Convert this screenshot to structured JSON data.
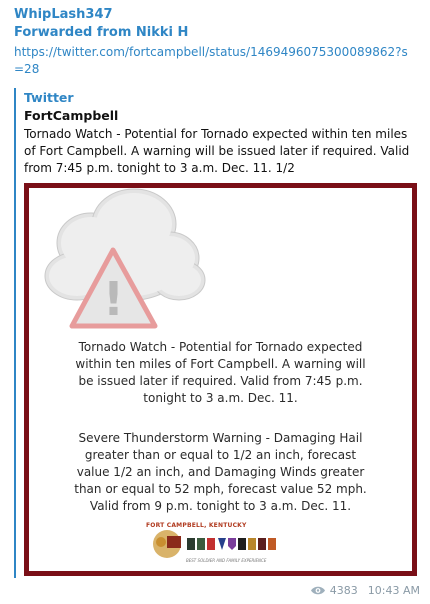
{
  "message": {
    "sender": "WhipLash347",
    "forwarded_from": "Forwarded from Nikki H",
    "link": "https://twitter.com/fortcampbell/status/1469496075300089862?s=28"
  },
  "preview": {
    "site_name": "Twitter",
    "title": "FortCampbell",
    "description": "Tornado Watch - Potential for Tornado expected within ten miles of Fort Campbell. A warning will be issued later if required. Valid from 7:45 p.m. tonight to 3 a.m. Dec. 11. 1/2"
  },
  "card": {
    "paragraph1": "Tornado Watch - Potential for Tornado expected within ten miles of Fort Campbell. A warning will be issued later if required. Valid from 7:45 p.m. tonight to 3 a.m. Dec. 11.",
    "paragraph2": "Severe Thunderstorm Warning - Damaging Hail greater than or equal to 1/2 an inch, forecast value 1/2 an inch, and Damaging Winds greater than or equal to 52 mph, forecast value 52 mph. Valid from 9 p.m. tonight to 3 a.m. Dec. 11.",
    "logo_title": "FORT CAMPBELL, KENTUCKY",
    "logo_subtitle": "BEST SOLDIER AND FAMILY EXPERIENCE",
    "warning_symbol": "!",
    "border_color": "#7a0f17"
  },
  "footer": {
    "views": "4383",
    "time": "10:43 AM",
    "views_icon": "eye-icon"
  }
}
